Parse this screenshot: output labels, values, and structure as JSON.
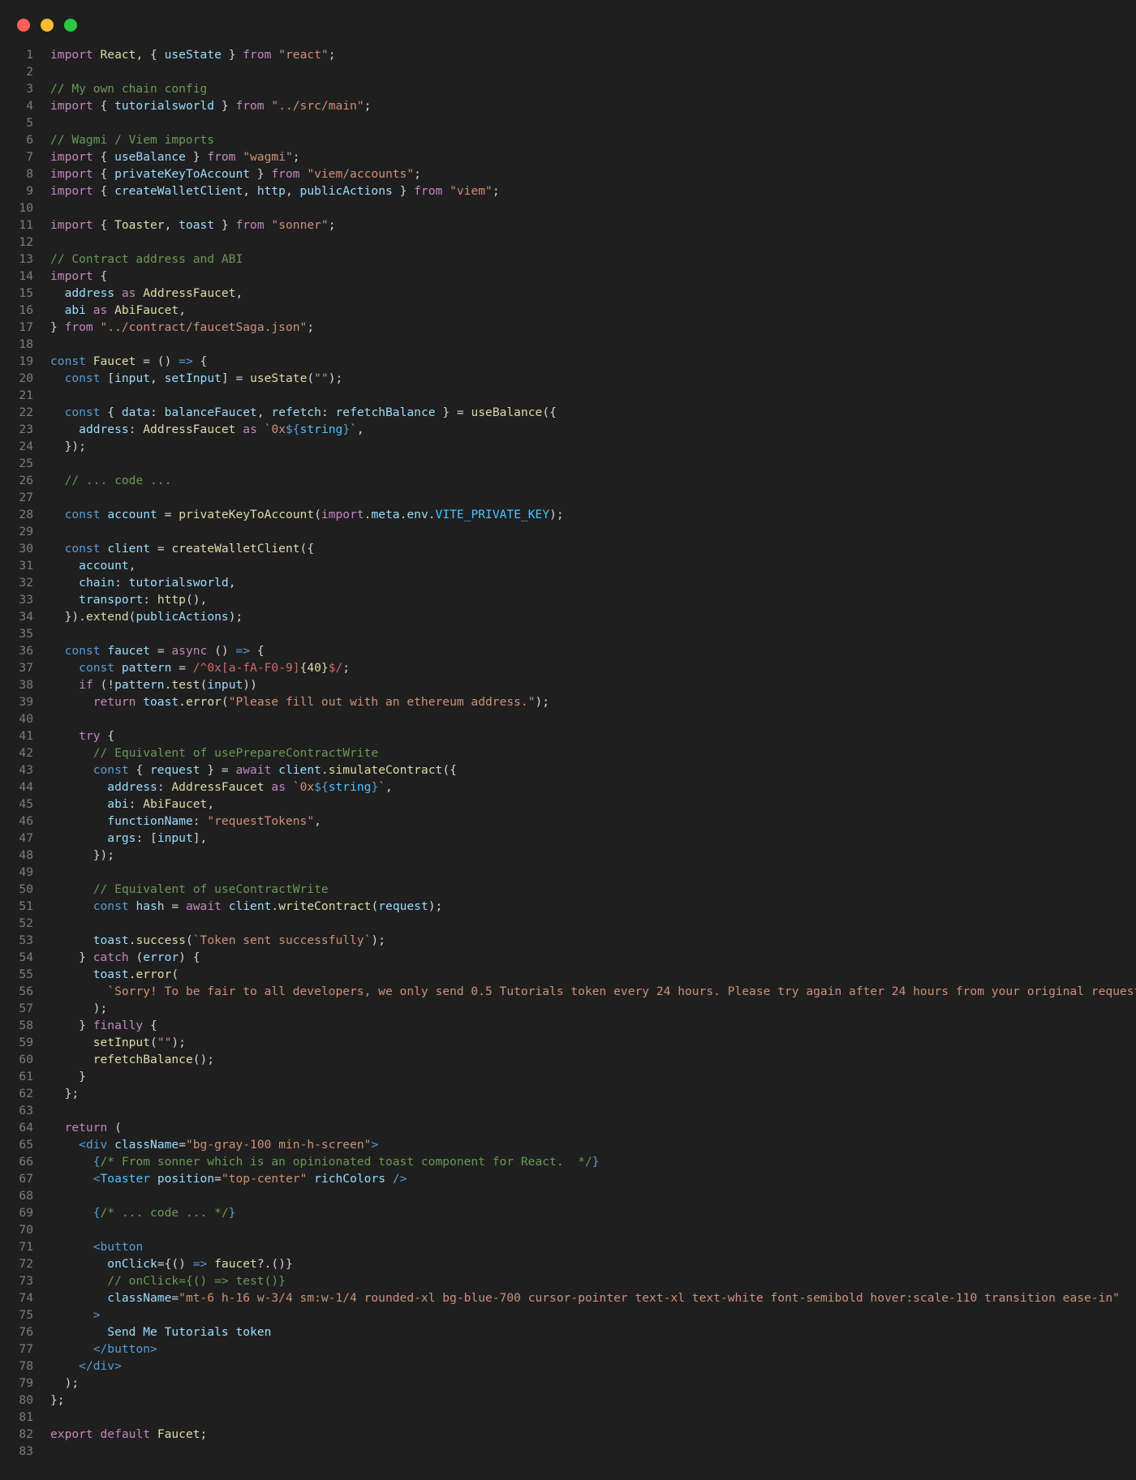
{
  "window": {
    "controls": [
      "close",
      "minimize",
      "maximize"
    ],
    "colors": {
      "close": "#fe5f57",
      "minimize": "#febc2e",
      "maximize": "#28c840",
      "background": "#1f1f1f"
    }
  },
  "editor": {
    "language": "jsx",
    "lines": [
      "import React, { useState } from \"react\";",
      "",
      "// My own chain config",
      "import { tutorialsworld } from \"../src/main\";",
      "",
      "// Wagmi / Viem imports",
      "import { useBalance } from \"wagmi\";",
      "import { privateKeyToAccount } from \"viem/accounts\";",
      "import { createWalletClient, http, publicActions } from \"viem\";",
      "",
      "import { Toaster, toast } from \"sonner\";",
      "",
      "// Contract address and ABI",
      "import {",
      "  address as AddressFaucet,",
      "  abi as AbiFaucet,",
      "} from \"../contract/faucetSaga.json\";",
      "",
      "const Faucet = () => {",
      "  const [input, setInput] = useState(\"\");",
      "",
      "  const { data: balanceFaucet, refetch: refetchBalance } = useBalance({",
      "    address: AddressFaucet as `0x${string}`,",
      "  });",
      "",
      "  // ... code ...",
      "",
      "  const account = privateKeyToAccount(import.meta.env.VITE_PRIVATE_KEY);",
      "",
      "  const client = createWalletClient({",
      "    account,",
      "    chain: tutorialsworld,",
      "    transport: http(),",
      "  }).extend(publicActions);",
      "",
      "  const faucet = async () => {",
      "    const pattern = /^0x[a-fA-F0-9]{40}$/;",
      "    if (!pattern.test(input))",
      "      return toast.error(\"Please fill out with an ethereum address.\");",
      "",
      "    try {",
      "      // Equivalent of usePrepareContractWrite",
      "      const { request } = await client.simulateContract({",
      "        address: AddressFaucet as `0x${string}`,",
      "        abi: AbiFaucet,",
      "        functionName: \"requestTokens\",",
      "        args: [input],",
      "      });",
      "",
      "      // Equivalent of useContractWrite",
      "      const hash = await client.writeContract(request);",
      "",
      "      toast.success(`Token sent successfully`);",
      "    } catch (error) {",
      "      toast.error(",
      "        `Sorry! To be fair to all developers, we only send 0.5 Tutorials token every 24 hours. Please try again after 24 hours from your original request.`",
      "      );",
      "    } finally {",
      "      setInput(\"\");",
      "      refetchBalance();",
      "    }",
      "  };",
      "",
      "  return (",
      "    <div className=\"bg-gray-100 min-h-screen\">",
      "      {/* From sonner which is an opinionated toast component for React.  */}",
      "      <Toaster position=\"top-center\" richColors />",
      "",
      "      {/* ... code ... */}",
      "",
      "      <button",
      "        onClick={() => faucet?.()}",
      "        // onClick={() => test()}",
      "        className=\"mt-6 h-16 w-3/4 sm:w-1/4 rounded-xl bg-blue-700 cursor-pointer text-xl text-white font-semibold hover:scale-110 transition ease-in\"",
      "      >",
      "        Send Me Tutorials token",
      "      </button>",
      "    </div>",
      "  );",
      "};",
      "",
      "export default Faucet;",
      ""
    ]
  }
}
